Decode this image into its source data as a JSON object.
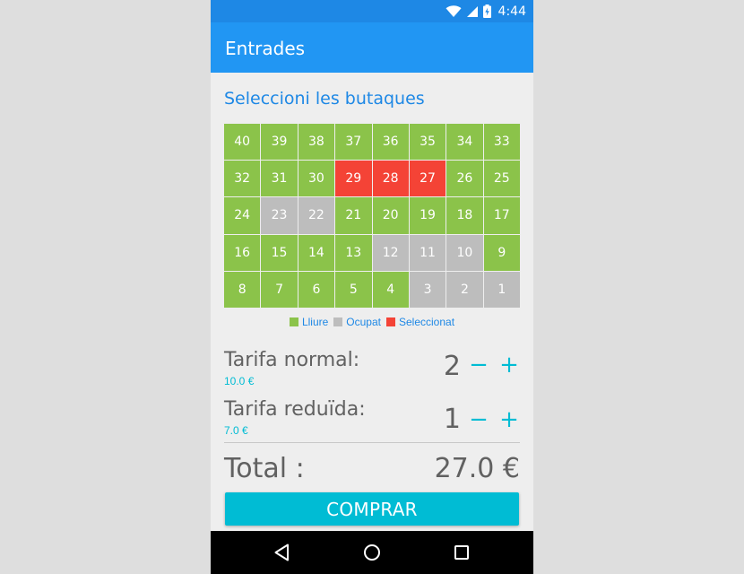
{
  "status_bar": {
    "time": "4:44"
  },
  "app_bar": {
    "title": "Entrades"
  },
  "seat_section": {
    "title": "Seleccioni les butaques"
  },
  "seats": [
    {
      "n": "40",
      "s": "free"
    },
    {
      "n": "39",
      "s": "free"
    },
    {
      "n": "38",
      "s": "free"
    },
    {
      "n": "37",
      "s": "free"
    },
    {
      "n": "36",
      "s": "free"
    },
    {
      "n": "35",
      "s": "free"
    },
    {
      "n": "34",
      "s": "free"
    },
    {
      "n": "33",
      "s": "free"
    },
    {
      "n": "32",
      "s": "free"
    },
    {
      "n": "31",
      "s": "free"
    },
    {
      "n": "30",
      "s": "free"
    },
    {
      "n": "29",
      "s": "selected"
    },
    {
      "n": "28",
      "s": "selected"
    },
    {
      "n": "27",
      "s": "selected"
    },
    {
      "n": "26",
      "s": "free"
    },
    {
      "n": "25",
      "s": "free"
    },
    {
      "n": "24",
      "s": "free"
    },
    {
      "n": "23",
      "s": "taken"
    },
    {
      "n": "22",
      "s": "taken"
    },
    {
      "n": "21",
      "s": "free"
    },
    {
      "n": "20",
      "s": "free"
    },
    {
      "n": "19",
      "s": "free"
    },
    {
      "n": "18",
      "s": "free"
    },
    {
      "n": "17",
      "s": "free"
    },
    {
      "n": "16",
      "s": "free"
    },
    {
      "n": "15",
      "s": "free"
    },
    {
      "n": "14",
      "s": "free"
    },
    {
      "n": "13",
      "s": "free"
    },
    {
      "n": "12",
      "s": "taken"
    },
    {
      "n": "11",
      "s": "taken"
    },
    {
      "n": "10",
      "s": "taken"
    },
    {
      "n": "9",
      "s": "free"
    },
    {
      "n": "8",
      "s": "free"
    },
    {
      "n": "7",
      "s": "free"
    },
    {
      "n": "6",
      "s": "free"
    },
    {
      "n": "5",
      "s": "free"
    },
    {
      "n": "4",
      "s": "free"
    },
    {
      "n": "3",
      "s": "taken"
    },
    {
      "n": "2",
      "s": "taken"
    },
    {
      "n": "1",
      "s": "taken"
    }
  ],
  "legend": {
    "free": {
      "label": "Lliure",
      "color": "#8bc34a"
    },
    "taken": {
      "label": "Ocupat",
      "color": "#bdbdbd"
    },
    "selected": {
      "label": "Seleccionat",
      "color": "#f44336"
    }
  },
  "fares": {
    "normal": {
      "name": "Tarifa normal:",
      "price": "10.0 €",
      "quantity": "2",
      "minus": "−",
      "plus": "+"
    },
    "reduced": {
      "name": "Tarifa reduïda:",
      "price": "7.0 €",
      "quantity": "1",
      "minus": "−",
      "plus": "+"
    }
  },
  "total": {
    "label": "Total :",
    "value": "27.0 €"
  },
  "buy_button": {
    "label": "COMPRAR"
  },
  "nav_icons": [
    "back-icon",
    "home-icon",
    "recents-icon"
  ]
}
